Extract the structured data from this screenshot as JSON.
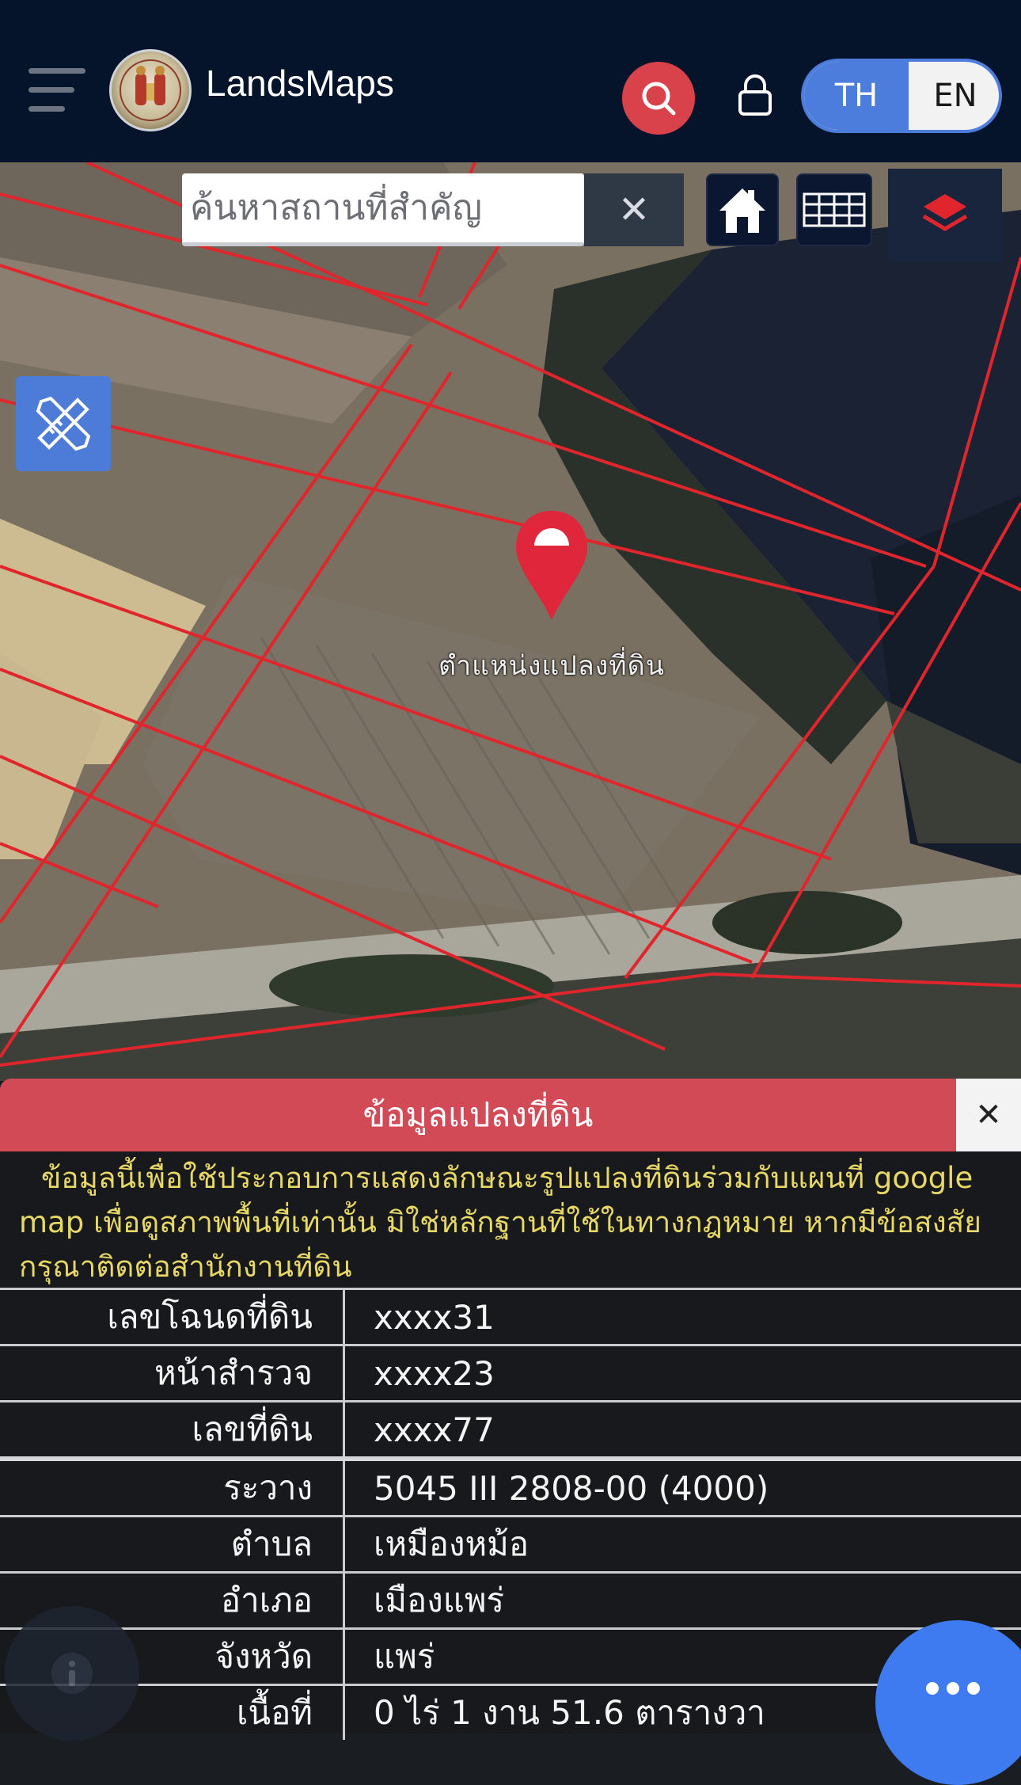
{
  "header": {
    "app_title": "LandsMaps",
    "menu_icon": "hamburger-menu-icon",
    "logo_icon": "landsmaps-seal-logo",
    "search_icon": "search-icon",
    "lock_icon": "lock-icon",
    "lang_th": "TH",
    "lang_en": "EN",
    "active_lang": "TH",
    "accent": "#4c7cdc",
    "search_btn_color": "#d9414b"
  },
  "map": {
    "search_placeholder": "ค้นหาสถานที่สำคัญ",
    "search_value": "",
    "clear_symbol": "✕",
    "home_icon": "home-icon",
    "grid_icon": "grid-icon",
    "layers_icon": "layers-icon",
    "measure_icon": "ruler-pencil-icon",
    "pin_icon": "map-pin-icon",
    "pin_label": "ตำแหน่งแปลงที่ดิน",
    "parcel_line_color": "#e0262c"
  },
  "panel": {
    "title": "ข้อมูลแปลงที่ดิน",
    "close_symbol": "✕",
    "header_color": "#d24a55",
    "disclaimer": "ข้อมูลนี้เพื่อใช้ประกอบการแสดงลักษณะรูปแปลงที่ดินร่วมกับแผนที่ google map เพื่อดูสภาพพื้นที่เท่านั้น มิใช่หลักฐานที่ใช้ในทางกฎหมาย หากมีข้อสงสัยกรุณาติดต่อสำนักงานที่ดิน",
    "rows": [
      {
        "label": "เลขโฉนดที่ดิน",
        "value": "xxxx31"
      },
      {
        "label": "หน้าสำรวจ",
        "value": "xxxx23"
      },
      {
        "label": "เลขที่ดิน",
        "value": "xxxx77"
      },
      {
        "label": "ระวาง",
        "value": "5045 III 2808-00 (4000)"
      },
      {
        "label": "ตำบล",
        "value": "เหมืองหม้อ"
      },
      {
        "label": "อำเภอ",
        "value": "เมืองแพร่"
      },
      {
        "label": "จังหวัด",
        "value": "แพร่"
      },
      {
        "label": "เนื้อที่",
        "value": "0 ไร่ 1 งาน 51.6 ตารางวา"
      }
    ]
  },
  "fabs": {
    "info_icon": "info-icon",
    "more_icon": "more-dots-icon",
    "more_color": "#3f7bf0"
  }
}
